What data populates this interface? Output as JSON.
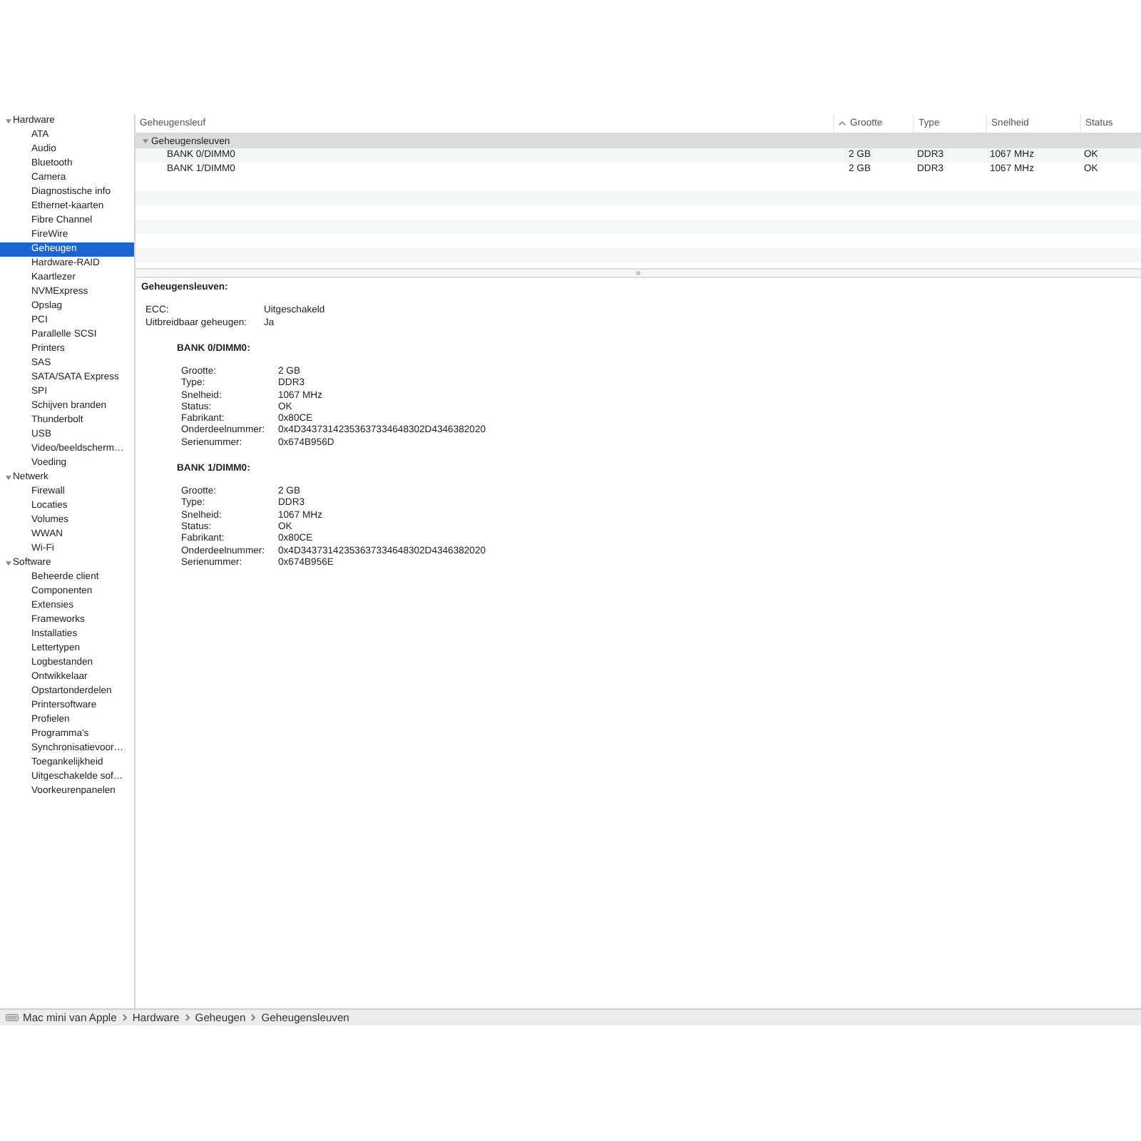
{
  "sidebar": {
    "sections": [
      {
        "label": "Hardware",
        "expanded": true,
        "selected": false,
        "children": [
          {
            "label": "ATA",
            "selected": false
          },
          {
            "label": "Audio",
            "selected": false
          },
          {
            "label": "Bluetooth",
            "selected": false
          },
          {
            "label": "Camera",
            "selected": false
          },
          {
            "label": "Diagnostische info",
            "selected": false
          },
          {
            "label": "Ethernet-kaarten",
            "selected": false
          },
          {
            "label": "Fibre Channel",
            "selected": false
          },
          {
            "label": "FireWire",
            "selected": false
          },
          {
            "label": "Geheugen",
            "selected": true
          },
          {
            "label": "Hardware-RAID",
            "selected": false
          },
          {
            "label": "Kaartlezer",
            "selected": false
          },
          {
            "label": "NVMExpress",
            "selected": false
          },
          {
            "label": "Opslag",
            "selected": false
          },
          {
            "label": "PCI",
            "selected": false
          },
          {
            "label": "Parallelle SCSI",
            "selected": false
          },
          {
            "label": "Printers",
            "selected": false
          },
          {
            "label": "SAS",
            "selected": false
          },
          {
            "label": "SATA/SATA Express",
            "selected": false
          },
          {
            "label": "SPI",
            "selected": false
          },
          {
            "label": "Schijven branden",
            "selected": false
          },
          {
            "label": "Thunderbolt",
            "selected": false
          },
          {
            "label": "USB",
            "selected": false
          },
          {
            "label": "Video/beeldscherm…",
            "selected": false
          },
          {
            "label": "Voeding",
            "selected": false
          }
        ]
      },
      {
        "label": "Netwerk",
        "expanded": true,
        "selected": false,
        "children": [
          {
            "label": "Firewall",
            "selected": false
          },
          {
            "label": "Locaties",
            "selected": false
          },
          {
            "label": "Volumes",
            "selected": false
          },
          {
            "label": "WWAN",
            "selected": false
          },
          {
            "label": "Wi-Fi",
            "selected": false
          }
        ]
      },
      {
        "label": "Software",
        "expanded": true,
        "selected": false,
        "children": [
          {
            "label": "Beheerde client",
            "selected": false
          },
          {
            "label": "Componenten",
            "selected": false
          },
          {
            "label": "Extensies",
            "selected": false
          },
          {
            "label": "Frameworks",
            "selected": false
          },
          {
            "label": "Installaties",
            "selected": false
          },
          {
            "label": "Lettertypen",
            "selected": false
          },
          {
            "label": "Logbestanden",
            "selected": false
          },
          {
            "label": "Ontwikkelaar",
            "selected": false
          },
          {
            "label": "Opstartonderdelen",
            "selected": false
          },
          {
            "label": "Printersoftware",
            "selected": false
          },
          {
            "label": "Profielen",
            "selected": false
          },
          {
            "label": "Programma's",
            "selected": false
          },
          {
            "label": "Synchronisatievoor…",
            "selected": false
          },
          {
            "label": "Toegankelijkheid",
            "selected": false
          },
          {
            "label": "Uitgeschakelde sof…",
            "selected": false
          },
          {
            "label": "Voorkeurenpanelen",
            "selected": false
          }
        ]
      }
    ]
  },
  "table": {
    "columns": [
      {
        "label": "Geheugensleuf",
        "sorted": false
      },
      {
        "label": "Grootte",
        "sorted": true
      },
      {
        "label": "Type",
        "sorted": false
      },
      {
        "label": "Snelheid",
        "sorted": false
      },
      {
        "label": "Status",
        "sorted": false
      }
    ],
    "groups": [
      {
        "label": "Geheugensleuven",
        "expanded": true,
        "selected": true,
        "rows": [
          {
            "cells": [
              "BANK 0/DIMM0",
              "2 GB",
              "DDR3",
              "1067 MHz",
              "OK"
            ],
            "selected": false
          },
          {
            "cells": [
              "BANK 1/DIMM0",
              "2 GB",
              "DDR3",
              "1067 MHz",
              "OK"
            ],
            "selected": false
          }
        ]
      }
    ]
  },
  "detail": {
    "title": "Geheugensleuven:",
    "fields": [
      {
        "label": "ECC:",
        "value": "Uitgeschakeld"
      },
      {
        "label": "Uitbreidbaar geheugen:",
        "value": "Ja"
      }
    ],
    "banks": [
      {
        "title": "BANK 0/DIMM0:",
        "fields": [
          {
            "label": "Grootte:",
            "value": "2 GB"
          },
          {
            "label": "Type:",
            "value": "DDR3"
          },
          {
            "label": "Snelheid:",
            "value": "1067 MHz"
          },
          {
            "label": "Status:",
            "value": "OK"
          },
          {
            "label": "Fabrikant:",
            "value": "0x80CE"
          },
          {
            "label": "Onderdeelnummer:",
            "value": "0x4D34373142353637334648302D4346382020"
          },
          {
            "label": "Serienummer:",
            "value": "0x674B956D"
          }
        ]
      },
      {
        "title": "BANK 1/DIMM0:",
        "fields": [
          {
            "label": "Grootte:",
            "value": "2 GB"
          },
          {
            "label": "Type:",
            "value": "DDR3"
          },
          {
            "label": "Snelheid:",
            "value": "1067 MHz"
          },
          {
            "label": "Status:",
            "value": "OK"
          },
          {
            "label": "Fabrikant:",
            "value": "0x80CE"
          },
          {
            "label": "Onderdeelnummer:",
            "value": "0x4D34373142353637334648302D4346382020"
          },
          {
            "label": "Serienummer:",
            "value": "0x674B956E"
          }
        ]
      }
    ]
  },
  "status_bar": {
    "path": [
      "Mac mini van Apple",
      "Hardware",
      "Geheugen",
      "Geheugensleuven"
    ]
  }
}
